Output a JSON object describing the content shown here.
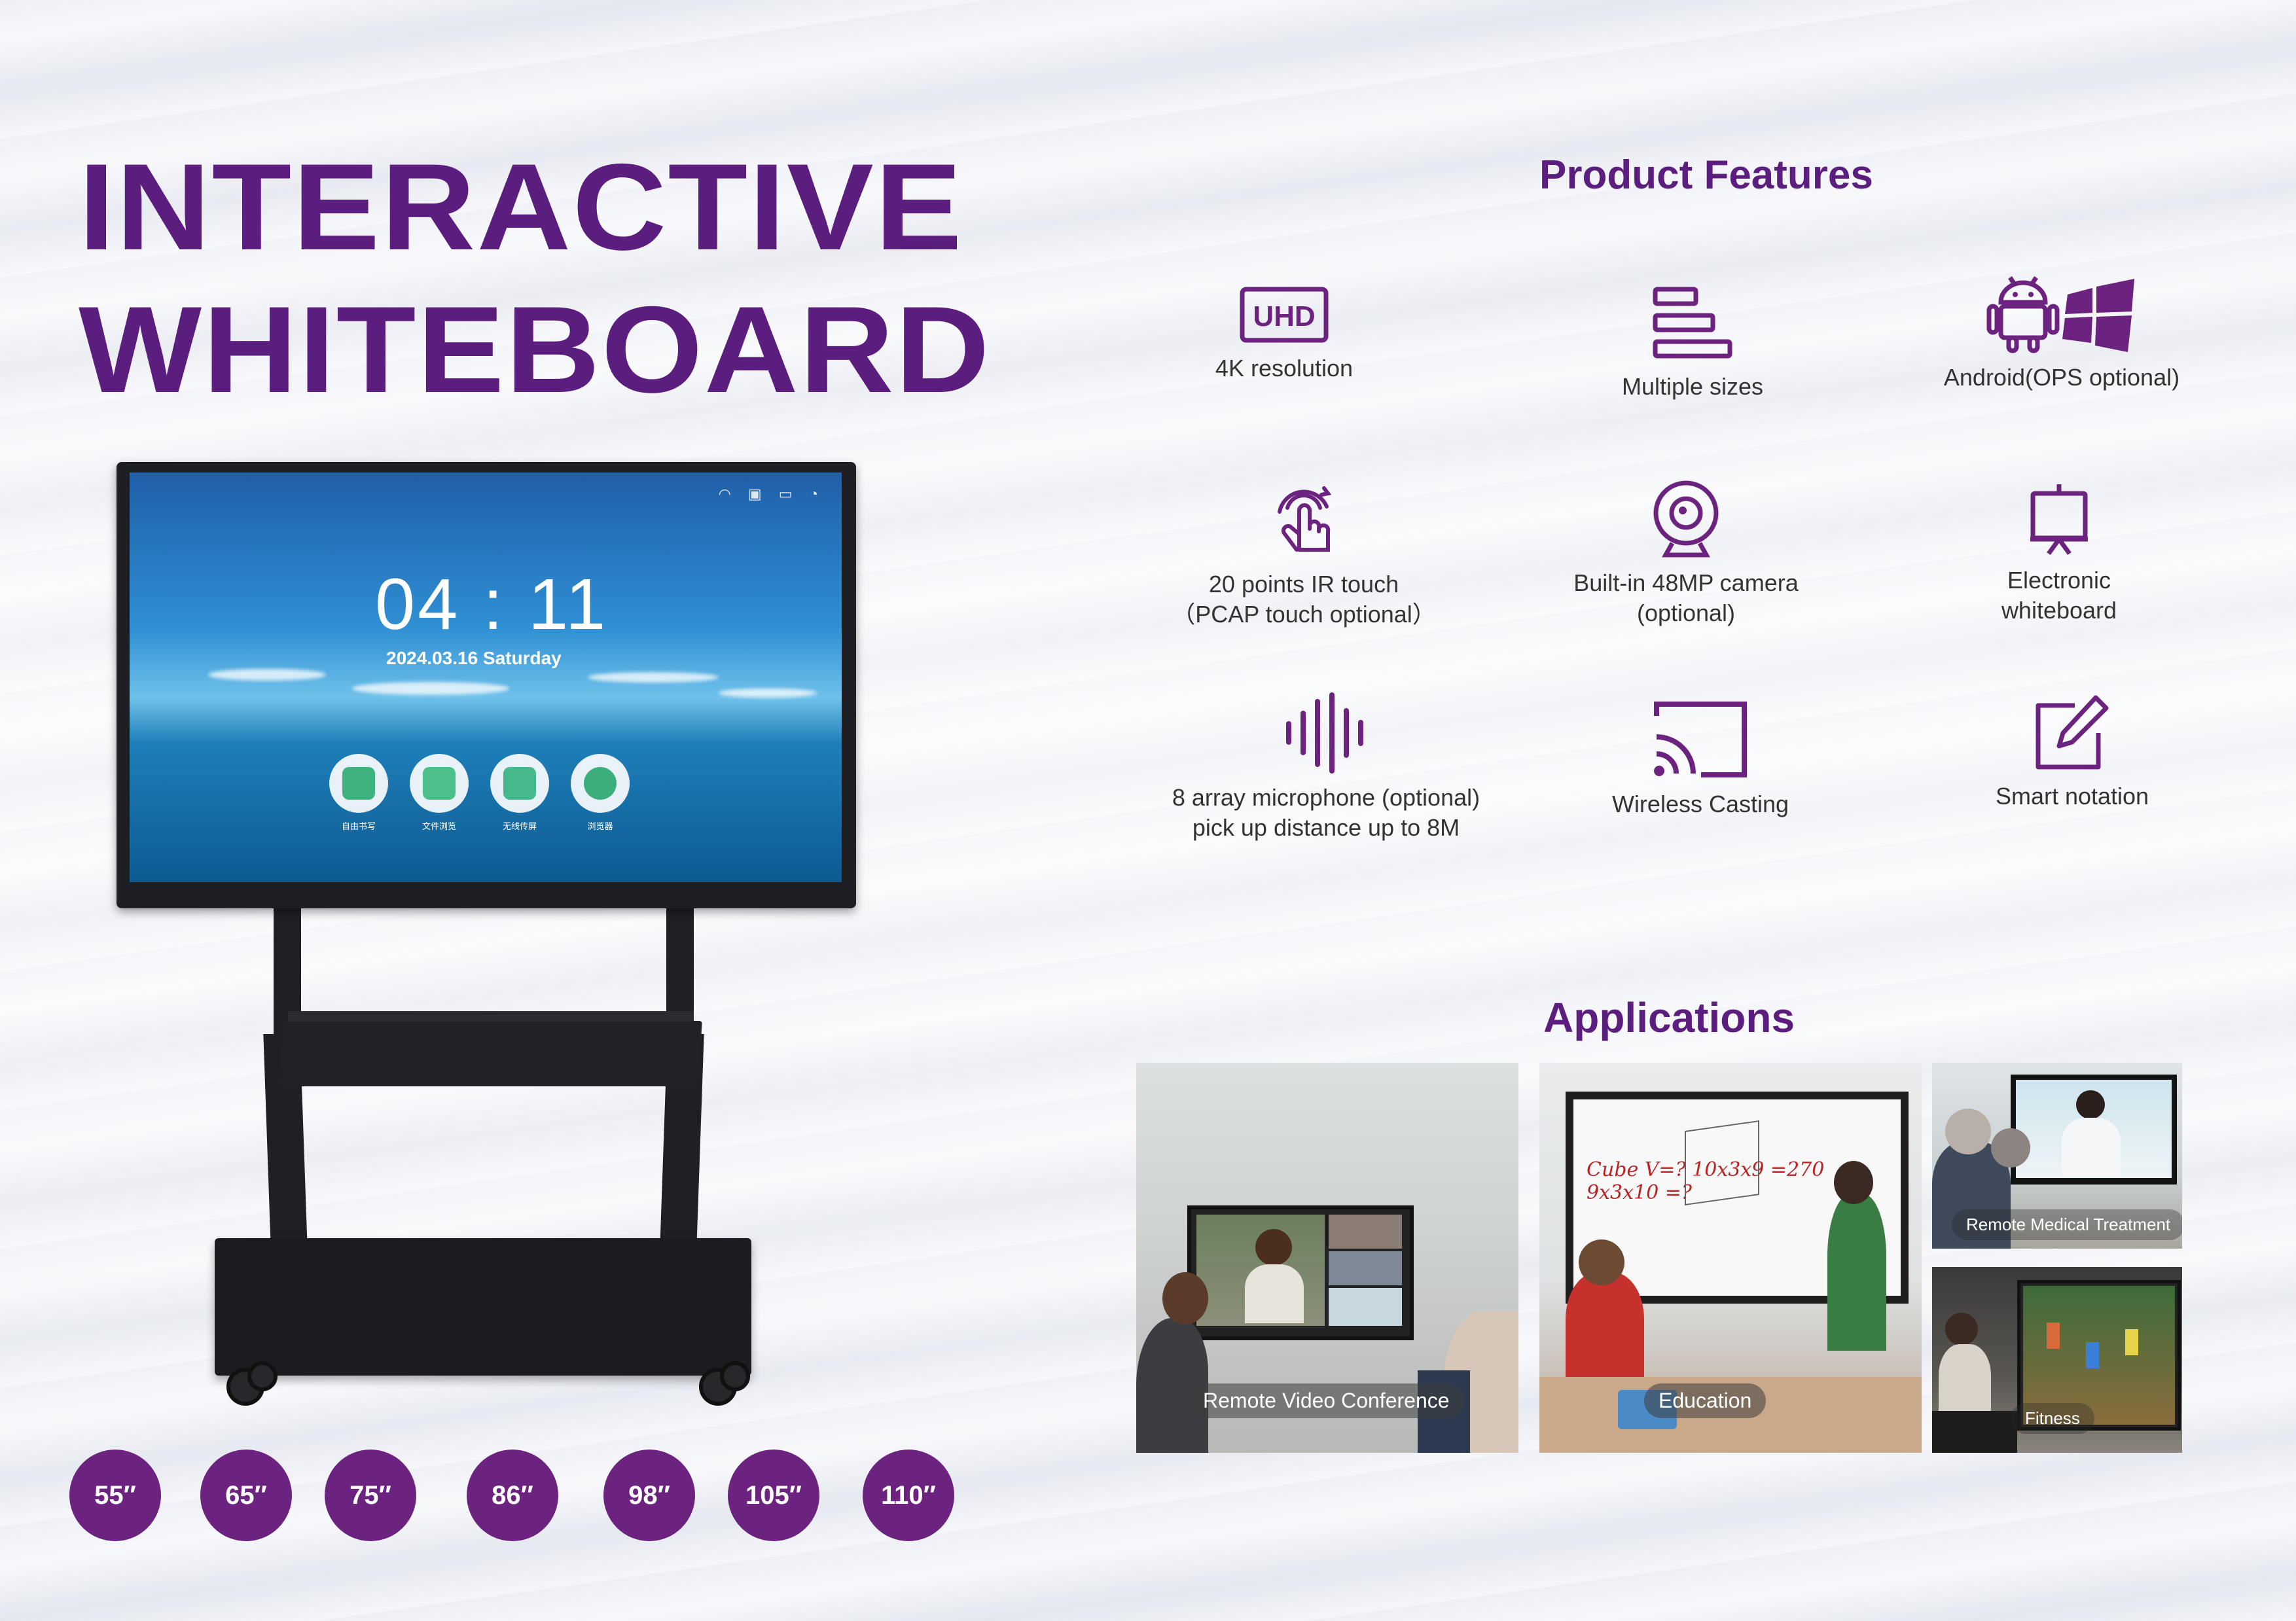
{
  "header": {
    "title_line1": "INTERACTIVE",
    "title_line2": "WHITEBOARD"
  },
  "device_screen": {
    "time": "04 : 11",
    "date": "2024.03.16 Saturday",
    "status_icons": "◠ ▣ ▭ ◔",
    "apps": [
      "自由书写",
      "文件浏览",
      "无线传屏",
      "浏览器"
    ]
  },
  "sizes": [
    "55′′",
    "65′′",
    "75′′",
    "86′′",
    "98′′",
    "105′′",
    "110′′"
  ],
  "features": {
    "title": "Product Features",
    "items": [
      {
        "icon": "uhd-icon",
        "label": "4K resolution"
      },
      {
        "icon": "multiple-sizes-icon",
        "label": "Multiple sizes"
      },
      {
        "icon": "android-windows-icon",
        "label": "Android(OPS optional)"
      },
      {
        "icon": "touch-icon",
        "label": "20 points IR touch\n（PCAP touch optional）"
      },
      {
        "icon": "camera-icon",
        "label": "Built-in 48MP camera\n(optional)"
      },
      {
        "icon": "whiteboard-icon",
        "label": "Electronic\nwhiteboard"
      },
      {
        "icon": "microphone-icon",
        "label": "8 array microphone (optional)\npick up distance up to 8M"
      },
      {
        "icon": "cast-icon",
        "label": "Wireless Casting"
      },
      {
        "icon": "notation-icon",
        "label": "Smart notation"
      }
    ]
  },
  "applications": {
    "title": "Applications",
    "items": [
      {
        "label": "Remote Video Conference"
      },
      {
        "label": "Education"
      },
      {
        "label": "Remote Medical Treatment"
      },
      {
        "label": "Fitness"
      }
    ],
    "education_board_text": "Cube  V=?  10x3x9 =270  9x3x10 =?"
  },
  "colors": {
    "brand_purple": "#5b1e7e",
    "circle_purple": "#6b237f"
  }
}
